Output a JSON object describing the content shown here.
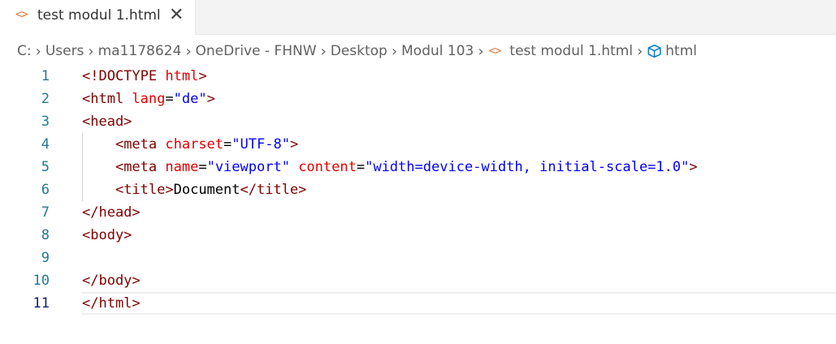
{
  "tab": {
    "icon": "code-icon",
    "label": "test modul 1.html",
    "close": "✕"
  },
  "breadcrumb": {
    "items": [
      "C:",
      "Users",
      "ma1178624",
      "OneDrive - FHNW",
      "Desktop",
      "Modul 103"
    ],
    "file": "test modul 1.html",
    "symbol": "html",
    "separator": "›"
  },
  "editor": {
    "active_line": 11,
    "lines": [
      {
        "number": "1",
        "tokens": [
          {
            "t": "tag",
            "v": "<!DOCTYPE "
          },
          {
            "t": "attr",
            "v": "html"
          },
          {
            "t": "tag",
            "v": ">"
          }
        ]
      },
      {
        "number": "2",
        "tokens": [
          {
            "t": "tag",
            "v": "<html "
          },
          {
            "t": "attr",
            "v": "lang"
          },
          {
            "t": "text",
            "v": "="
          },
          {
            "t": "val",
            "v": "\"de\""
          },
          {
            "t": "tag",
            "v": ">"
          }
        ]
      },
      {
        "number": "3",
        "tokens": [
          {
            "t": "tag",
            "v": "<head>"
          }
        ]
      },
      {
        "number": "4",
        "tokens": [
          {
            "t": "text",
            "v": "    "
          },
          {
            "t": "tag",
            "v": "<meta "
          },
          {
            "t": "attr",
            "v": "charset"
          },
          {
            "t": "text",
            "v": "="
          },
          {
            "t": "val",
            "v": "\"UTF-8\""
          },
          {
            "t": "tag",
            "v": ">"
          }
        ]
      },
      {
        "number": "5",
        "tokens": [
          {
            "t": "text",
            "v": "    "
          },
          {
            "t": "tag",
            "v": "<meta "
          },
          {
            "t": "attr",
            "v": "name"
          },
          {
            "t": "text",
            "v": "="
          },
          {
            "t": "val",
            "v": "\"viewport\""
          },
          {
            "t": "text",
            "v": " "
          },
          {
            "t": "attr",
            "v": "content"
          },
          {
            "t": "text",
            "v": "="
          },
          {
            "t": "val",
            "v": "\"width=device-width, initial-scale=1.0\""
          },
          {
            "t": "tag",
            "v": ">"
          }
        ]
      },
      {
        "number": "6",
        "tokens": [
          {
            "t": "text",
            "v": "    "
          },
          {
            "t": "tag",
            "v": "<title>"
          },
          {
            "t": "text",
            "v": "Document"
          },
          {
            "t": "tag",
            "v": "</title>"
          }
        ]
      },
      {
        "number": "7",
        "tokens": [
          {
            "t": "tag",
            "v": "</head>"
          }
        ]
      },
      {
        "number": "8",
        "tokens": [
          {
            "t": "tag",
            "v": "<body>"
          }
        ]
      },
      {
        "number": "9",
        "tokens": []
      },
      {
        "number": "10",
        "tokens": [
          {
            "t": "tag",
            "v": "</body>"
          }
        ]
      },
      {
        "number": "11",
        "tokens": [
          {
            "t": "tag",
            "v": "</html>"
          }
        ]
      }
    ]
  },
  "colors": {
    "tag": "#800000",
    "attribute": "#e50000",
    "value": "#0000ff",
    "text": "#000000",
    "line_number": "#237893",
    "active_line_number": "#0b216f",
    "file_icon": "#e37933",
    "symbol_icon": "#007acc"
  }
}
